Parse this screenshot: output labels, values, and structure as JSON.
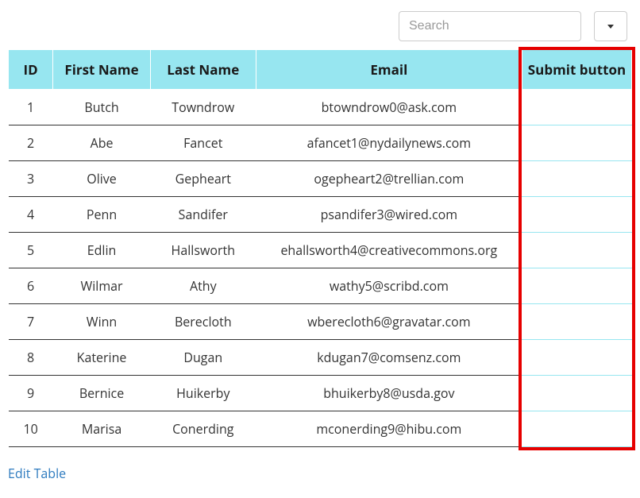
{
  "search": {
    "placeholder": "Search",
    "value": ""
  },
  "columns": {
    "id": "ID",
    "first": "First Name",
    "last": "Last Name",
    "email": "Email",
    "submit": "Submit button"
  },
  "rows": [
    {
      "id": "1",
      "first": "Butch",
      "last": "Towndrow",
      "email": "btowndrow0@ask.com"
    },
    {
      "id": "2",
      "first": "Abe",
      "last": "Fancet",
      "email": "afancet1@nydailynews.com"
    },
    {
      "id": "3",
      "first": "Olive",
      "last": "Gepheart",
      "email": "ogepheart2@trellian.com"
    },
    {
      "id": "4",
      "first": "Penn",
      "last": "Sandifer",
      "email": "psandifer3@wired.com"
    },
    {
      "id": "5",
      "first": "Edlin",
      "last": "Hallsworth",
      "email": "ehallsworth4@creativecommons.org"
    },
    {
      "id": "6",
      "first": "Wilmar",
      "last": "Athy",
      "email": "wathy5@scribd.com"
    },
    {
      "id": "7",
      "first": "Winn",
      "last": "Berecloth",
      "email": "wberecloth6@gravatar.com"
    },
    {
      "id": "8",
      "first": "Katerine",
      "last": "Dugan",
      "email": "kdugan7@comsenz.com"
    },
    {
      "id": "9",
      "first": "Bernice",
      "last": "Huikerby",
      "email": "bhuikerby8@usda.gov"
    },
    {
      "id": "10",
      "first": "Marisa",
      "last": "Conerding",
      "email": "mconerding9@hibu.com"
    }
  ],
  "edit_link_label": "Edit Table",
  "colors": {
    "header_bg": "#97e6f0",
    "highlight_border": "#e60000",
    "link": "#2e7bbf"
  }
}
